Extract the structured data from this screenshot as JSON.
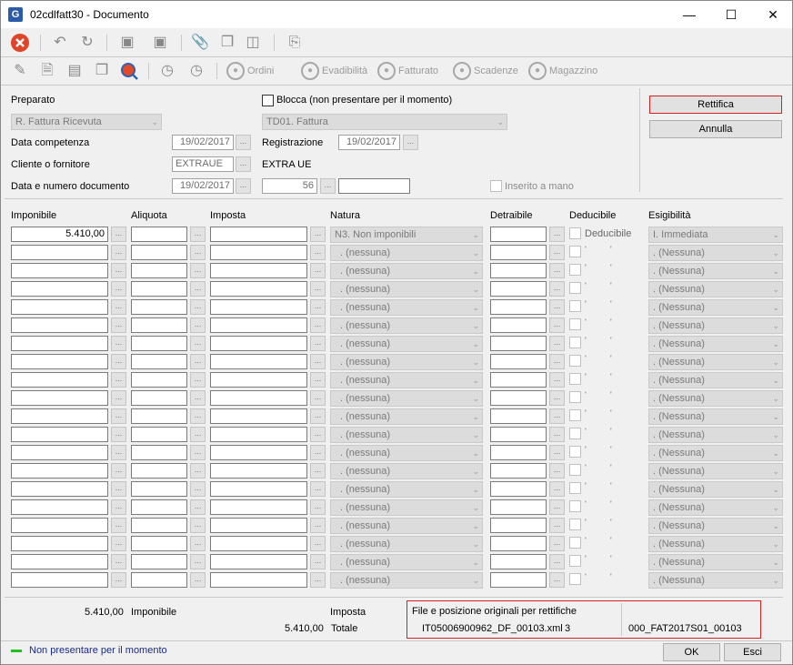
{
  "window": {
    "title": "02cdlfatt30 - Documento",
    "app_icon": "G"
  },
  "toolbar2": {
    "ordini": "Ordini",
    "evadibilita": "Evadibilità",
    "fatturato": "Fatturato",
    "scadenze": "Scadenze",
    "magazzino": "Magazzino"
  },
  "header": {
    "preparato_label": "Preparato",
    "preparato_value": "R. Fattura Ricevuta",
    "blocca_label": "Blocca (non presentare per il momento)",
    "tipo_doc": "TD01. Fattura",
    "data_competenza_label": "Data competenza",
    "data_competenza": "19/02/2017",
    "registrazione_label": "Registrazione",
    "registrazione": "19/02/2017",
    "cliente_label": "Cliente o fornitore",
    "cliente_code": "EXTRAUE",
    "cliente_name": "EXTRA UE",
    "data_num_label": "Data e numero documento",
    "data_doc": "19/02/2017",
    "num_doc": "56",
    "num_doc_suffix": "",
    "inserito_label": "Inserito a mano"
  },
  "actions": {
    "rettifica": "Rettifica",
    "annulla": "Annulla"
  },
  "grid": {
    "headers": {
      "imponibile": "Imponibile",
      "aliquota": "Aliquota",
      "imposta": "Imposta",
      "natura": "Natura",
      "detraibile": "Detraibile",
      "deducibile": "Deducibile",
      "esigibilita": "Esigibilità"
    },
    "first_row": {
      "imponibile": "5.410,00",
      "natura": "N3. Non imponibili",
      "deducibile": "Deducibile",
      "esigibilita": "I. Immediata"
    },
    "empty_natura": ". (nessuna)",
    "empty_esigibilita": ". (Nessuna)"
  },
  "totals": {
    "imponibile_value": "5.410,00",
    "imponibile_label": "Imponibile",
    "imposta_label": "Imposta",
    "totale_value": "5.410,00",
    "totale_label": "Totale"
  },
  "rettifica_info": {
    "title": "File e posizione originali per rettifiche",
    "file": "IT05006900962_DF_00103.xml",
    "position": "3",
    "ref": "000_FAT2017S01_00103"
  },
  "status": {
    "text": "Non presentare per il momento",
    "indicator_color": "#22c022"
  },
  "footer": {
    "ok": "OK",
    "esci": "Esci"
  }
}
